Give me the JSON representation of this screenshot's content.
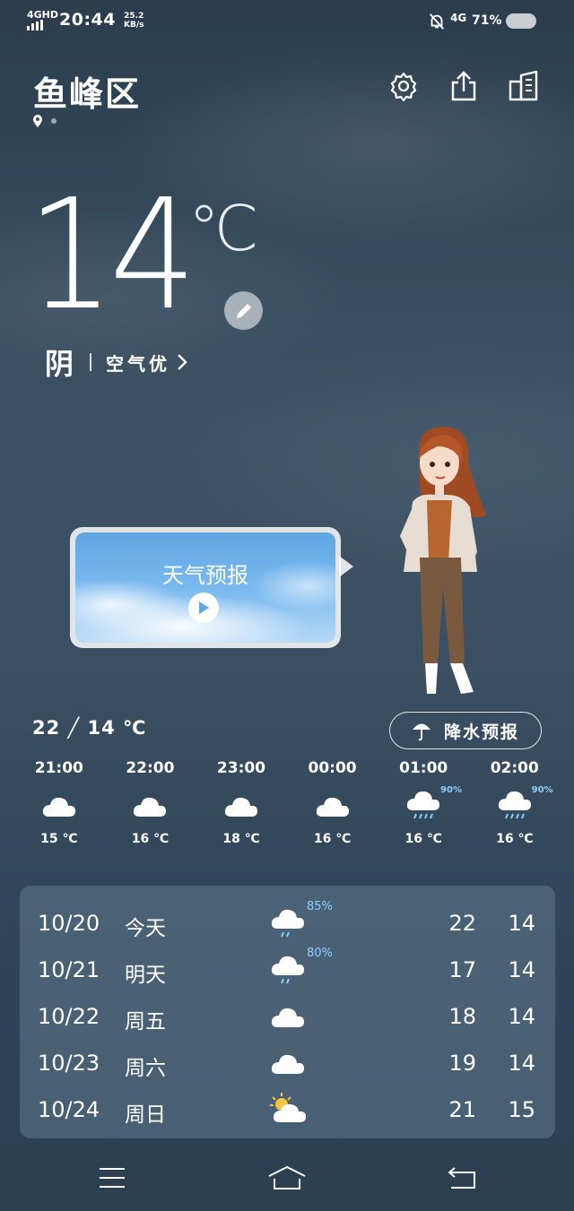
{
  "status_bar": {
    "network": "4GHD",
    "time": "20:44",
    "speed_value": "25.2",
    "speed_unit": "KB/s",
    "network2": "4G",
    "battery": "71%"
  },
  "header": {
    "city": "鱼峰区"
  },
  "current": {
    "temperature": "14",
    "unit": "℃",
    "condition": "阴",
    "air_quality": "空气优"
  },
  "video": {
    "title": "天气预报"
  },
  "today": {
    "range": "22 ╱ 14 ℃",
    "rain_forecast_label": "降水预报"
  },
  "hourly": [
    {
      "time": "21:00",
      "icon": "cloudy-icon",
      "temp": "15 ℃",
      "precip": ""
    },
    {
      "time": "22:00",
      "icon": "cloudy-icon",
      "temp": "16 ℃",
      "precip": ""
    },
    {
      "time": "23:00",
      "icon": "cloudy-icon",
      "temp": "18 ℃",
      "precip": ""
    },
    {
      "time": "00:00",
      "icon": "cloudy-icon",
      "temp": "16 ℃",
      "precip": ""
    },
    {
      "time": "01:00",
      "icon": "rain-icon",
      "temp": "16 ℃",
      "precip": "90%"
    },
    {
      "time": "02:00",
      "icon": "rain-icon",
      "temp": "16 ℃",
      "precip": "90%"
    }
  ],
  "daily": [
    {
      "date": "10/20",
      "day": "今天",
      "icon": "rain-icon",
      "precip": "85%",
      "high": "22",
      "low": "14"
    },
    {
      "date": "10/21",
      "day": "明天",
      "icon": "rain-icon",
      "precip": "80%",
      "high": "17",
      "low": "14"
    },
    {
      "date": "10/22",
      "day": "周五",
      "icon": "cloudy-icon",
      "precip": "",
      "high": "18",
      "low": "14"
    },
    {
      "date": "10/23",
      "day": "周六",
      "icon": "cloudy-icon",
      "precip": "",
      "high": "19",
      "low": "14"
    },
    {
      "date": "10/24",
      "day": "周日",
      "icon": "partly-sunny-icon",
      "precip": "",
      "high": "21",
      "low": "15"
    }
  ],
  "colors": {
    "precip_text": "#8fd0ff",
    "sun": "#f5c542"
  }
}
